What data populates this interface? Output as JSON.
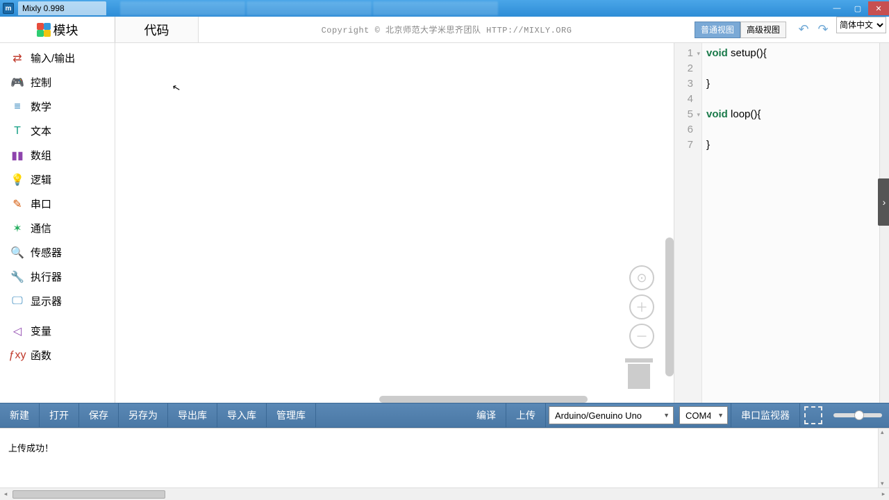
{
  "titlebar": {
    "app_name": "Mixly 0.998"
  },
  "toprow": {
    "module_tab": "模块",
    "code_tab": "代码",
    "copyright": "Copyright  ©  北京师范大学米思齐团队  HTTP://MIXLY.ORG",
    "view_normal": "普通视图",
    "view_advanced": "高级视图",
    "lang": "简体中文"
  },
  "categories": [
    {
      "label": "输入/输出",
      "icon": "⇄",
      "color": "#c0392b"
    },
    {
      "label": "控制",
      "icon": "🎮",
      "color": "#27ae60"
    },
    {
      "label": "数学",
      "icon": "≡",
      "color": "#2980b9"
    },
    {
      "label": "文本",
      "icon": "T",
      "color": "#16a085"
    },
    {
      "label": "数组",
      "icon": "▮▮",
      "color": "#8e44ad"
    },
    {
      "label": "逻辑",
      "icon": "💡",
      "color": "#2980b9"
    },
    {
      "label": "串口",
      "icon": "✎",
      "color": "#d35400"
    },
    {
      "label": "通信",
      "icon": "✶",
      "color": "#27ae60"
    },
    {
      "label": "传感器",
      "icon": "🔍",
      "color": "#16a085"
    },
    {
      "label": "执行器",
      "icon": "🔧",
      "color": "#27ae60"
    },
    {
      "label": "显示器",
      "icon": "🖵",
      "color": "#2980b9"
    },
    {
      "label": "变量",
      "icon": "◁",
      "color": "#8e44ad",
      "sep": true
    },
    {
      "label": "函数",
      "icon": "ƒxy",
      "color": "#c0392b"
    }
  ],
  "code": {
    "lines": [
      {
        "n": 1,
        "fold": true,
        "tokens": [
          [
            "kw",
            "void "
          ],
          [
            "fn",
            "setup"
          ],
          [
            "",
            "(){"
          ]
        ]
      },
      {
        "n": 2,
        "fold": false,
        "tokens": [
          [
            "",
            ""
          ]
        ]
      },
      {
        "n": 3,
        "fold": false,
        "tokens": [
          [
            "",
            "}"
          ]
        ]
      },
      {
        "n": 4,
        "fold": false,
        "tokens": [
          [
            "",
            ""
          ]
        ]
      },
      {
        "n": 5,
        "fold": true,
        "tokens": [
          [
            "kw",
            "void "
          ],
          [
            "fn",
            "loop"
          ],
          [
            "",
            "(){"
          ]
        ]
      },
      {
        "n": 6,
        "fold": false,
        "tokens": [
          [
            "",
            ""
          ]
        ]
      },
      {
        "n": 7,
        "fold": false,
        "tokens": [
          [
            "",
            "}"
          ]
        ]
      }
    ]
  },
  "bottombar": {
    "new": "新建",
    "open": "打开",
    "save": "保存",
    "saveas": "另存为",
    "exportlib": "导出库",
    "importlib": "导入库",
    "managelib": "管理库",
    "compile": "编译",
    "upload": "上传",
    "board": "Arduino/Genuino Uno",
    "port": "COM4",
    "serial_monitor": "串口监视器"
  },
  "console": {
    "message": "上传成功！"
  }
}
